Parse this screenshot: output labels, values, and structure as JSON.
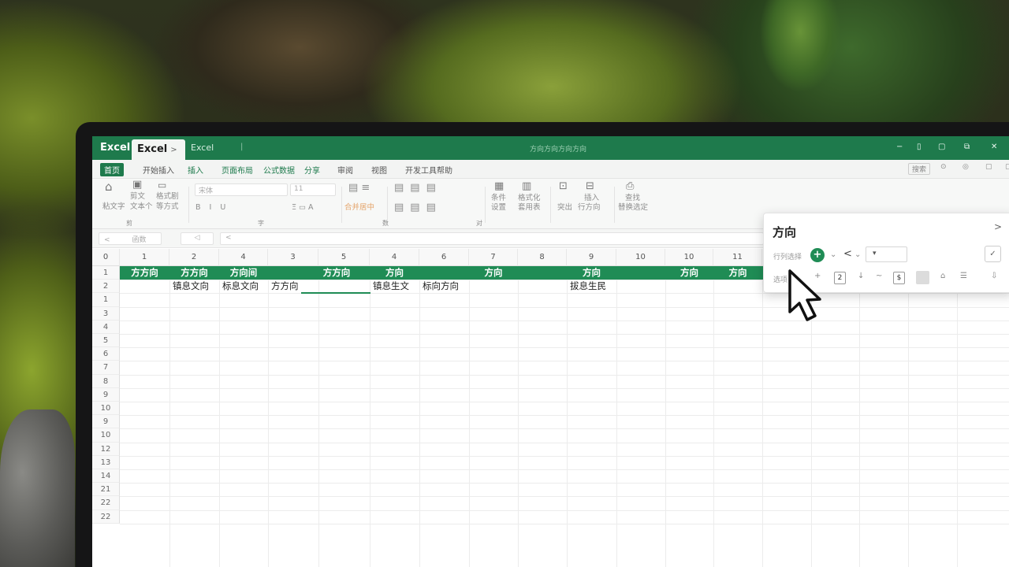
{
  "window": {
    "app_label": "Excel",
    "active_tab": "Excel",
    "active_tab_close": ">",
    "second_tab": "Excel",
    "separator": "|",
    "center_title": "方向方向方向方向",
    "controls": [
      "−",
      "▯",
      "▢",
      "⧉",
      "✕"
    ]
  },
  "menu": {
    "items": [
      "首页",
      "开始插入",
      "插入",
      "页面布局",
      "公式数据",
      "分享",
      "审阅",
      "视图",
      "开发工具帮助"
    ],
    "right_items": [
      "搜索",
      "⊙",
      "◎",
      "▢",
      "▢"
    ]
  },
  "ribbon": {
    "paste_label": "粘文字",
    "cut_label": "剪文",
    "copy_label": "文本个",
    "format_painter_label": "格式剧",
    "format_painter_label2": "等方式",
    "font_name": "宋体",
    "font_size": "11",
    "font_row2": "B I U",
    "merge_label": "合并居中",
    "group_clipboard": "剪",
    "group_font": "字",
    "group_align": "对",
    "group_number": "数",
    "styles_label": "条件",
    "styles_label2": "设置",
    "format_label": "格式化",
    "format_label2": "套用表",
    "insert_label": "突出",
    "insert_label2": "插入",
    "insert_label3": "行方向",
    "find_label": "查找",
    "find_label2": "替换选定"
  },
  "formula_bar": {
    "name_box": "函数",
    "nav_back": "<",
    "fx": "◁",
    "content": "<"
  },
  "columns": [
    "1",
    "2",
    "4",
    "3",
    "5",
    "4",
    "6",
    "7",
    "8",
    "9",
    "10",
    "10",
    "11"
  ],
  "corner": "0",
  "rows": [
    "1",
    "2",
    "1",
    "3",
    "4",
    "5",
    "6",
    "7",
    "8",
    "9",
    "10",
    "9",
    "10",
    "12",
    "13",
    "14",
    "21",
    "22",
    "22"
  ],
  "header_row": [
    "方方向",
    "方方向",
    "方向间",
    "",
    "方方向",
    "方向",
    "",
    "方向",
    "",
    "方向",
    "",
    "方向",
    "方向"
  ],
  "data_row": [
    "",
    "镇息文向",
    "标息文向",
    "方方向",
    "",
    "镇息生文",
    "标向方向",
    "",
    "",
    "拔息生民",
    "",
    "",
    ""
  ],
  "panel": {
    "title": "方向",
    "close": ">",
    "row1_label": "行列选择",
    "plus": "+",
    "chev1": "⌄",
    "back": "<",
    "chev2": "⌄",
    "dropdown": "▾",
    "check": "✓",
    "row2_label": "选项",
    "sym1": "+",
    "chip1": "2",
    "sym2": "↓",
    "sym3": "~",
    "chip2": "$",
    "sym4": "⌂",
    "sym5": "☰",
    "sym6": "⇩"
  },
  "colors": {
    "accent": "#1f8c55",
    "titlebar": "#1e7a4c"
  }
}
